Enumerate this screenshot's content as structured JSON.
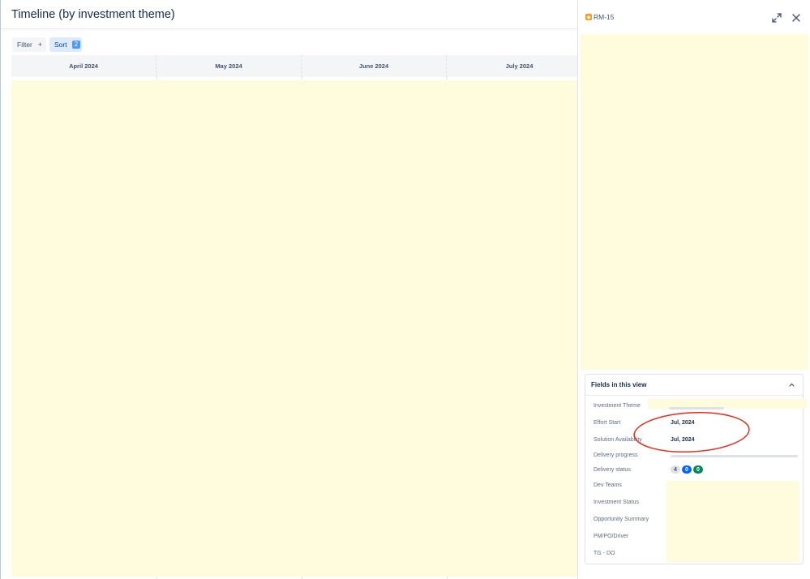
{
  "header": {
    "title": "Timeline (by investment theme)"
  },
  "toolbar": {
    "filter_label": "Filter",
    "filter_plus": "+",
    "sort_label": "Sort",
    "sort_count": "2"
  },
  "timeline": {
    "months": [
      "April 2024",
      "May 2024",
      "June 2024",
      "July 2024"
    ]
  },
  "side_panel": {
    "issue_key": "RM-15",
    "issue_icon": "roadmap-item-icon",
    "fields": {
      "title": "Fields in this view",
      "labels": {
        "investment_theme": "Investment Theme",
        "effort_start": "Effort Start",
        "solution_availability": "Solution Availability",
        "delivery_progress": "Delivery progress",
        "delivery_status": "Delivery status",
        "dev_teams": "Dev Teams",
        "investment_status": "Investment Status",
        "opportunity_summary": "Opportunity Summary",
        "pm_po_driver": "PM/PO/Driver",
        "tg_do": "TG - DO"
      },
      "values": {
        "effort_start": "Jul, 2024",
        "solution_availability": "Jul, 2024",
        "delivery_progress_fraction": 0,
        "delivery_status": {
          "todo": "4",
          "in_progress": "0",
          "done": "0"
        }
      }
    }
  },
  "colors": {
    "highlight": "#fefcdc",
    "annotation": "#e0301e",
    "sort_bg": "#deebff",
    "status_blue": "#0065ff",
    "status_green": "#00875a"
  }
}
